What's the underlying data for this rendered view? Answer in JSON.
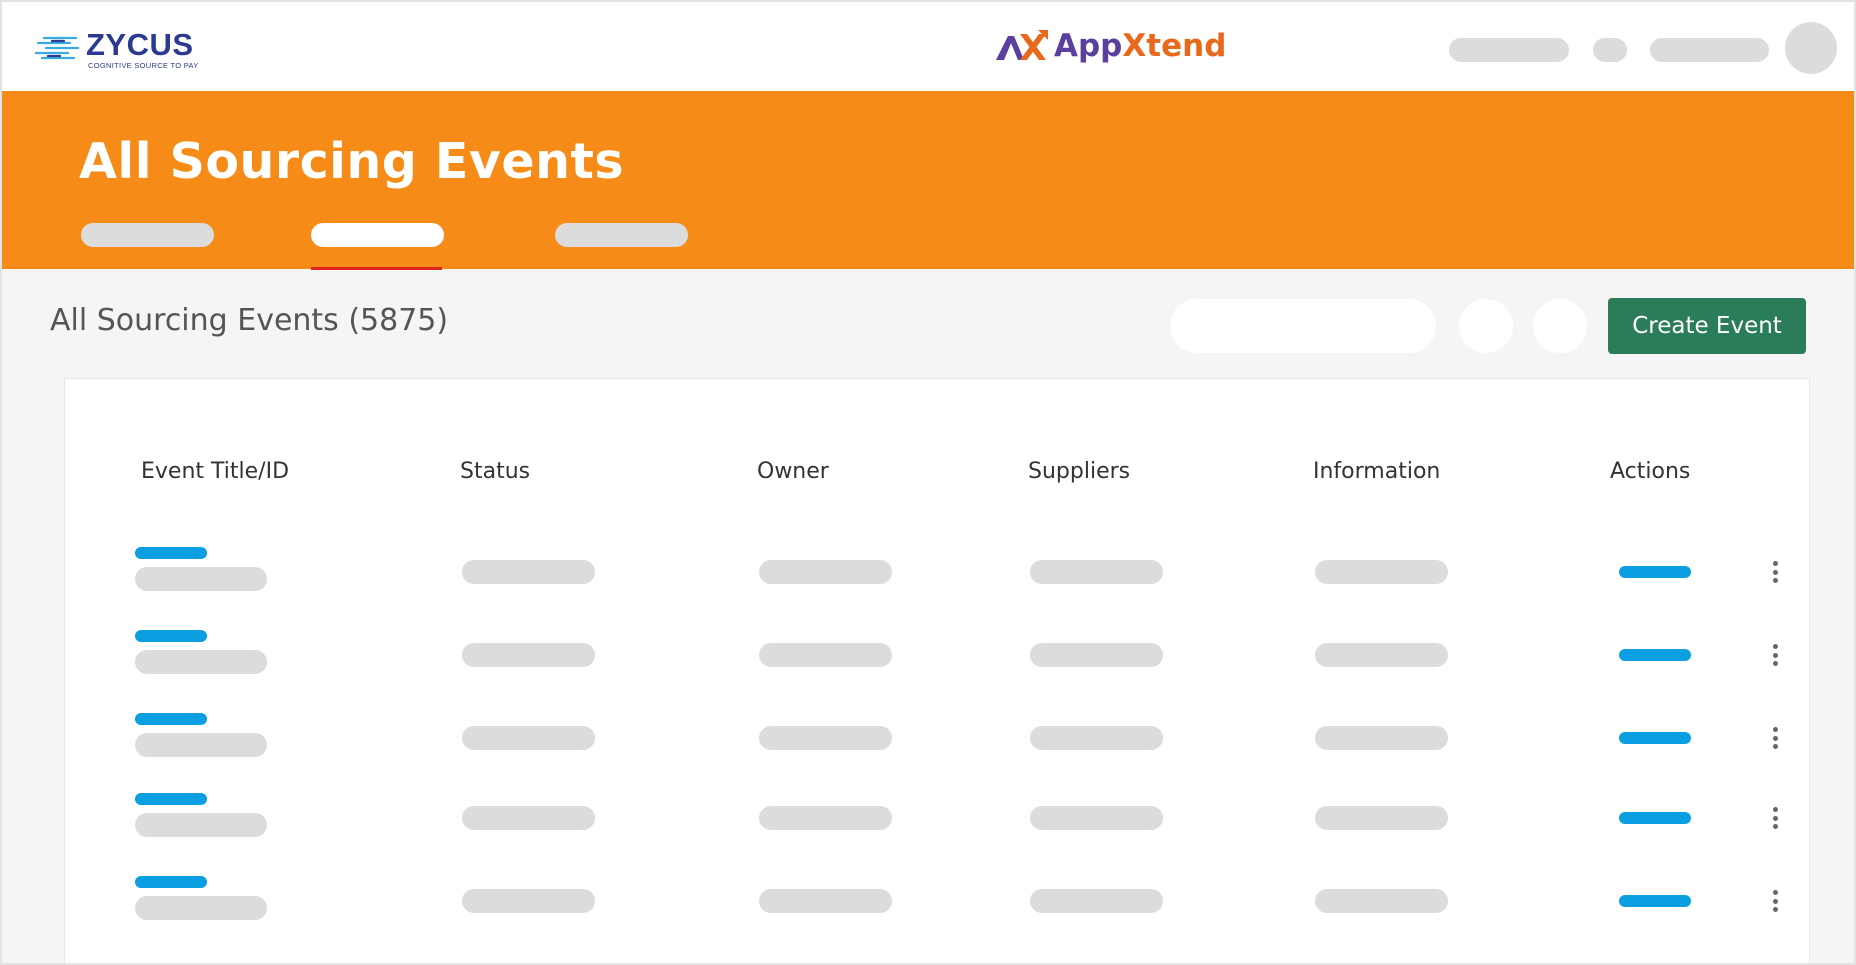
{
  "header": {
    "brand_name": "ZYCUS",
    "brand_tagline": "COGNITIVE SOURCE TO PAY",
    "app_name_part1": "App",
    "app_name_part2": "Xtend"
  },
  "banner": {
    "title": "All Sourcing Events",
    "active_tab_index": 1
  },
  "toolbar": {
    "count_title": "All Sourcing Events (5875)",
    "create_button_label": "Create Event"
  },
  "table": {
    "columns": [
      "Event Title/ID",
      "Status",
      "Owner",
      "Suppliers",
      "Information",
      "Actions"
    ]
  },
  "colors": {
    "banner": "#f68b17",
    "primary_button": "#2a7d58",
    "link_accent": "#0b9fe1",
    "active_tab_underline": "#e2231a",
    "zycus_blue": "#2b3990",
    "appxtend_purple": "#5b3f9e",
    "appxtend_orange": "#e8691c",
    "placeholder": "#dcdcdc"
  }
}
